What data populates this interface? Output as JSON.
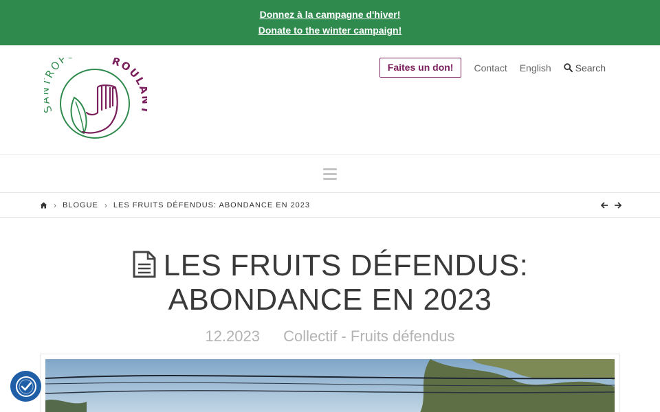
{
  "banner": {
    "line_fr": "Donnez à la campagne d'hiver!",
    "line_en": "Donate to the winter campaign!"
  },
  "logo": {
    "top_text": "SANTROPOL",
    "side_text": "ROULANT",
    "colors": {
      "purple": "#7b1f5c",
      "green": "#2f8a4d"
    }
  },
  "topnav": {
    "donate_label": "Faites un don!",
    "contact_label": "Contact",
    "language_label": "English",
    "search_label": "Search"
  },
  "breadcrumb": {
    "home_icon": "home-icon",
    "items": [
      "BLOGUE",
      "LES FRUITS DÉFENDUS: ABONDANCE EN 2023"
    ]
  },
  "post": {
    "title_line1": "LES FRUITS DÉFENDUS:",
    "title_line2": "ABONDANCE EN 2023",
    "date": "12.2023",
    "categories": "Collectif - Fruits défendus"
  },
  "colors": {
    "banner_bg": "#2f8a4d",
    "accent_purple": "#7b1f5c",
    "a11y_button": "#1f5fa8"
  }
}
